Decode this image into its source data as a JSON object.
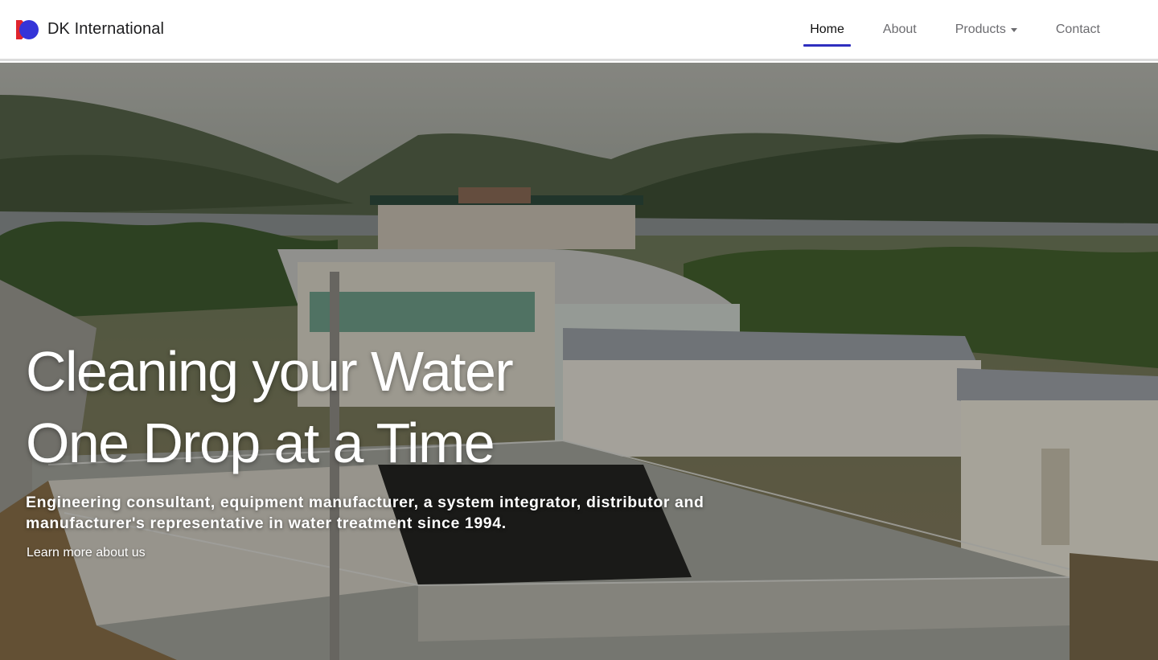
{
  "brand": {
    "name": "DK International",
    "logo_icon": "dk-logo-icon",
    "colors": {
      "logo_red": "#e0242d",
      "logo_blue": "#3434d8"
    }
  },
  "nav": {
    "items": [
      {
        "label": "Home",
        "active": true
      },
      {
        "label": "About",
        "active": false
      },
      {
        "label": "Products",
        "active": false,
        "dropdown": true
      },
      {
        "label": "Contact",
        "active": false
      }
    ],
    "accent_color": "#2f2fbf"
  },
  "hero": {
    "title_line1": "Cleaning your Water",
    "title_line2": "One Drop at a Time",
    "subtitle": "Engineering consultant, equipment manufacturer, a system integrator, distributor and manufacturer's representative in water treatment since 1994.",
    "cta_label": "Learn more about us",
    "background": "water-treatment-plant-photo"
  }
}
